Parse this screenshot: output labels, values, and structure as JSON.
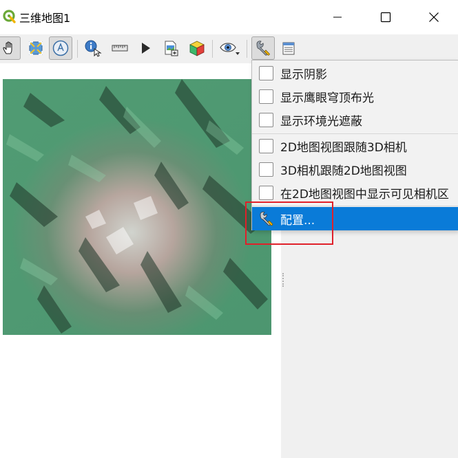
{
  "window": {
    "title": "三维地图1"
  },
  "titlebar_buttons": {
    "minimize": "minimize-icon",
    "maximize": "maximize-icon",
    "close": "close-icon"
  },
  "toolbar": {
    "buttons": [
      {
        "name": "pan-hand-icon",
        "pressed": true
      },
      {
        "name": "zoom-full-icon",
        "pressed": false
      },
      {
        "name": "camera-control-icon",
        "pressed": true
      },
      {
        "name": "identify-icon",
        "pressed": false
      },
      {
        "name": "measure-ruler-icon",
        "pressed": false
      },
      {
        "name": "play-animation-icon",
        "pressed": false
      },
      {
        "name": "export-scene-icon",
        "pressed": false
      },
      {
        "name": "3d-cube-icon",
        "pressed": false
      },
      {
        "name": "view-eye-icon",
        "pressed": false
      },
      {
        "name": "options-wrench-icon",
        "pressed": true
      },
      {
        "name": "map-themes-icon",
        "pressed": false
      }
    ]
  },
  "menu": {
    "items": [
      {
        "label": "显示阴影",
        "checked": false
      },
      {
        "label": "显示鹰眼穹顶布光",
        "checked": false
      },
      {
        "label": "显示环境光遮蔽",
        "checked": false
      },
      {
        "label": "2D地图视图跟随3D相机",
        "checked": false
      },
      {
        "label": "3D相机跟随2D地图视图",
        "checked": false
      },
      {
        "label": "在2D地图视图中显示可见相机区",
        "checked": false
      }
    ],
    "configure_label": "配置..."
  },
  "colors": {
    "menu_highlight": "#0a7bd8",
    "annotation": "#e0202a",
    "panel_bg": "#f0f0f0"
  }
}
